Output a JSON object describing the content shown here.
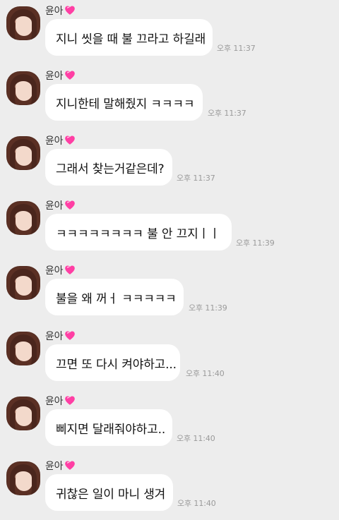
{
  "colors": {
    "background": "#ededed",
    "bubble": "#ffffff",
    "heart": "#ff3fa4",
    "time": "#9a9a9a"
  },
  "messages": [
    {
      "sender": "윤아",
      "icon": "pink-heart-icon",
      "text": "지니 씻을 때 불 끄라고 하길래",
      "time": "오후 11:37"
    },
    {
      "sender": "윤아",
      "icon": "pink-heart-icon",
      "text": "지니한테 말해줬지 ㅋㅋㅋㅋ",
      "time": "오후 11:37"
    },
    {
      "sender": "윤아",
      "icon": "pink-heart-icon",
      "text": "그래서 찾는거같은데?",
      "time": "오후 11:37"
    },
    {
      "sender": "윤아",
      "icon": "pink-heart-icon",
      "text": "ㅋㅋㅋㅋㅋㅋㅋㅋ 불 안 끄지ㅣㅣ",
      "time": "오후 11:39"
    },
    {
      "sender": "윤아",
      "icon": "pink-heart-icon",
      "text": "불을 왜 꺼ㅓ ㅋㅋㅋㅋㅋ",
      "time": "오후 11:39"
    },
    {
      "sender": "윤아",
      "icon": "pink-heart-icon",
      "text": "끄면 또 다시 켜야하고...",
      "time": "오후 11:40"
    },
    {
      "sender": "윤아",
      "icon": "pink-heart-icon",
      "text": "삐지면 달래줘야하고..",
      "time": "오후 11:40"
    },
    {
      "sender": "윤아",
      "icon": "pink-heart-icon",
      "text": "귀찮은 일이 마니 생겨",
      "time": "오후 11:40"
    }
  ]
}
